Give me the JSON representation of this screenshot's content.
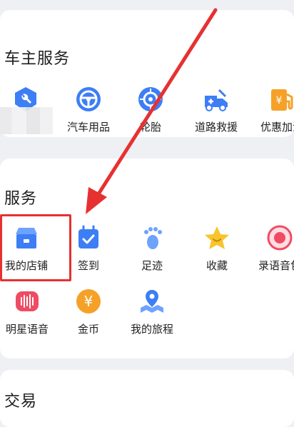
{
  "colors": {
    "blue": "#3d7ef5",
    "orange": "#f5a128",
    "red_annotation": "#e63131",
    "pink": "#ef4c63",
    "yellow": "#f7c52d"
  },
  "car_owner": {
    "title": "车主服务",
    "items": [
      {
        "label": "",
        "icon": "wrench-shield-icon"
      },
      {
        "label": "汽车用品",
        "icon": "steering-wheel-icon"
      },
      {
        "label": "轮胎",
        "icon": "tire-icon"
      },
      {
        "label": "道路救援",
        "icon": "tow-truck-icon"
      },
      {
        "label": "优惠加油",
        "icon": "fuel-coupon-icon"
      }
    ]
  },
  "services": {
    "title": "服务",
    "items": [
      {
        "label": "我的店铺",
        "icon": "shop-icon"
      },
      {
        "label": "签到",
        "icon": "calendar-check-icon"
      },
      {
        "label": "足迹",
        "icon": "footprint-icon"
      },
      {
        "label": "收藏",
        "icon": "star-icon"
      },
      {
        "label": "录语音包",
        "icon": "record-icon"
      },
      {
        "label": "明星语音",
        "icon": "voice-wave-icon"
      },
      {
        "label": "金币",
        "icon": "gold-coin-icon"
      },
      {
        "label": "我的旅程",
        "icon": "journey-map-icon"
      }
    ]
  },
  "trade": {
    "title": "交易"
  }
}
